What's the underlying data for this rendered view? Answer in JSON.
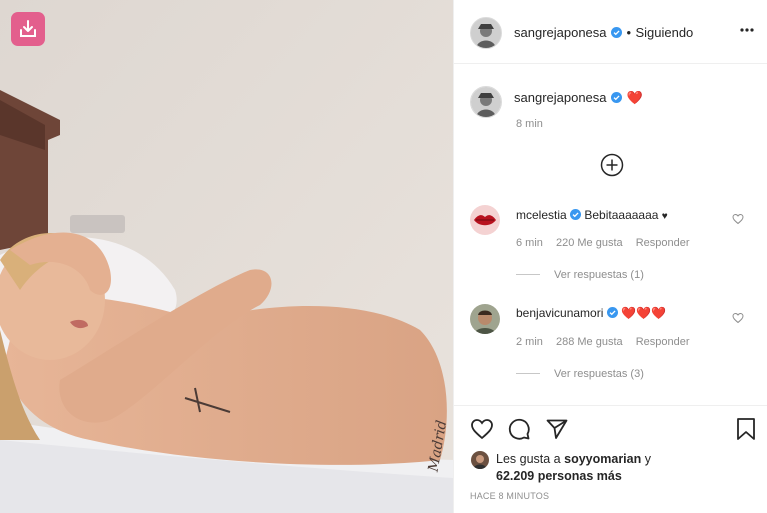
{
  "post": {
    "username": "sangrejaponesa",
    "follow_status": "Siguiendo",
    "caption_emoji": "❤️",
    "caption_time": "8 min",
    "more_icon": "more-options-icon",
    "download_icon": "download-icon"
  },
  "comments": [
    {
      "username": "mcelestia",
      "text": "Bebitaaaaaaa",
      "text_suffix": "♥",
      "time": "6 min",
      "likes": "220 Me gusta",
      "reply": "Responder",
      "view_replies": "Ver respuestas (1)"
    },
    {
      "username": "benjavicunamori",
      "text": "❤️❤️❤️",
      "time": "2 min",
      "likes": "288 Me gusta",
      "reply": "Responder",
      "view_replies": "Ver respuestas (3)"
    }
  ],
  "footer": {
    "liked_by_prefix": "Les gusta a",
    "liked_by_user": "soyyomarian",
    "liked_by_and": "y",
    "others": "62.209 personas más",
    "timestamp": "HACE 8 MINUTOS"
  },
  "photo": {
    "tattoo_text": "Madrid"
  },
  "colors": {
    "verified": "#3897f0",
    "heart": "#e0182d",
    "download_bg": "#e35f8d"
  }
}
